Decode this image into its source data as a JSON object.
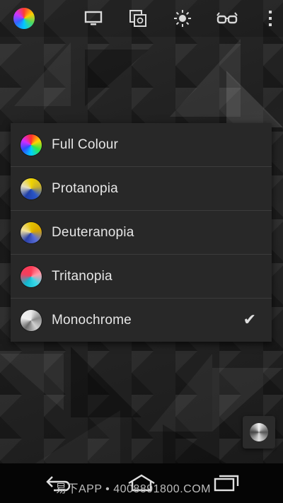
{
  "toolbar": {
    "icons": [
      "color-wheel-icon",
      "monitor-icon",
      "screenshot-icon",
      "brightness-icon",
      "glasses-icon",
      "more-vert-icon"
    ]
  },
  "menu": {
    "items": [
      {
        "label": "Full Colour",
        "icon": "full-colour-swatch-icon",
        "selected": false
      },
      {
        "label": "Protanopia",
        "icon": "protanopia-swatch-icon",
        "selected": false
      },
      {
        "label": "Deuteranopia",
        "icon": "deuteranopia-swatch-icon",
        "selected": false
      },
      {
        "label": "Tritanopia",
        "icon": "tritanopia-swatch-icon",
        "selected": false
      },
      {
        "label": "Monochrome",
        "icon": "monochrome-swatch-icon",
        "selected": true
      }
    ],
    "check_glyph": "✔"
  },
  "navbar": {
    "watermark": "易下APP • 4008891800.COM"
  },
  "colors": {
    "menu_bg": "#282828",
    "divider": "#3c3c3c",
    "text": "#e6e6e6",
    "background": "#1b1b1b"
  }
}
